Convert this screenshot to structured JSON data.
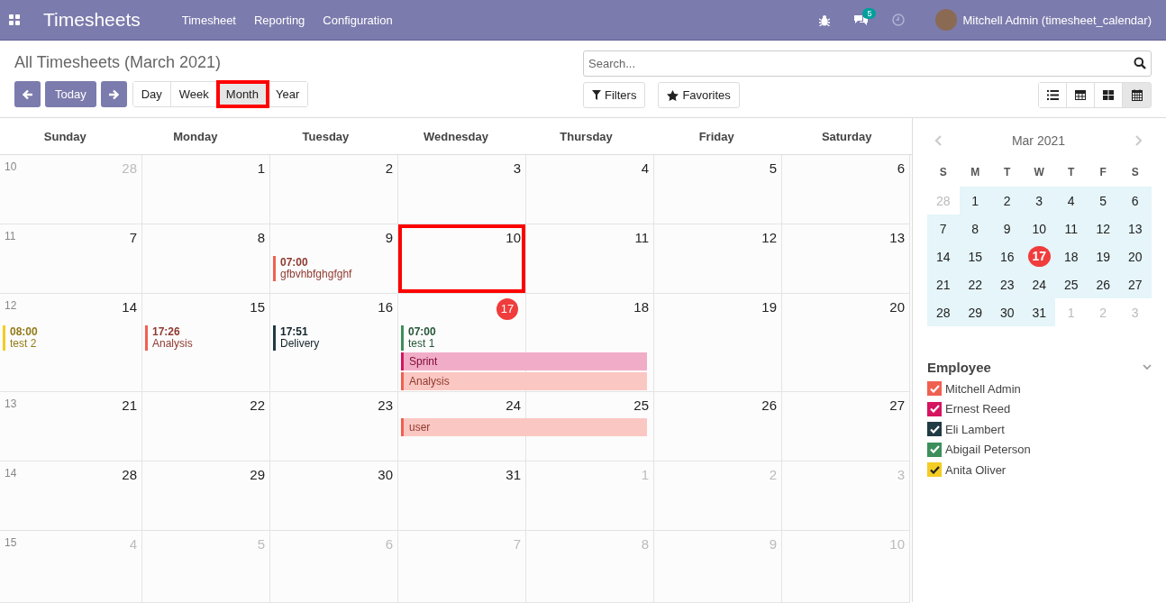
{
  "app": {
    "title": "Timesheets",
    "menu": [
      "Timesheet",
      "Reporting",
      "Configuration"
    ],
    "messages_badge": "5",
    "user": "Mitchell Admin (timesheet_calendar)"
  },
  "page": {
    "title": "All Timesheets (March 2021)",
    "today_button": "Today",
    "views": [
      {
        "label": "Day",
        "selected": false,
        "highlighted": false
      },
      {
        "label": "Week",
        "selected": false,
        "highlighted": false
      },
      {
        "label": "Month",
        "selected": true,
        "highlighted": true
      },
      {
        "label": "Year",
        "selected": false,
        "highlighted": false
      }
    ],
    "search": {
      "placeholder": "Search..."
    },
    "filters": "Filters",
    "favorites": "Favorites",
    "view_switcher": [
      {
        "kind": "list",
        "selected": false
      },
      {
        "kind": "pivot",
        "selected": false
      },
      {
        "kind": "kanban",
        "selected": false
      },
      {
        "kind": "calendar",
        "selected": true
      }
    ]
  },
  "calendar": {
    "weekdays": [
      "Sunday",
      "Monday",
      "Tuesday",
      "Wednesday",
      "Thursday",
      "Friday",
      "Saturday"
    ],
    "weeks": [
      {
        "number": "10",
        "days": [
          {
            "label": "28",
            "in_month": false,
            "today": false,
            "highlighted": false
          },
          {
            "label": "1",
            "in_month": true,
            "today": false,
            "highlighted": false
          },
          {
            "label": "2",
            "in_month": true,
            "today": false,
            "highlighted": false
          },
          {
            "label": "3",
            "in_month": true,
            "today": false,
            "highlighted": false
          },
          {
            "label": "4",
            "in_month": true,
            "today": false,
            "highlighted": false
          },
          {
            "label": "5",
            "in_month": true,
            "today": false,
            "highlighted": false
          },
          {
            "label": "6",
            "in_month": true,
            "today": false,
            "highlighted": false
          }
        ]
      },
      {
        "number": "11",
        "days": [
          {
            "label": "7",
            "in_month": true,
            "today": false,
            "highlighted": false
          },
          {
            "label": "8",
            "in_month": true,
            "today": false,
            "highlighted": false
          },
          {
            "label": "9",
            "in_month": true,
            "today": false,
            "highlighted": false,
            "events": [
              {
                "kind": "timed",
                "time": "07:00",
                "title": "gfbvhbfghgfghf",
                "color": "#f06050"
              }
            ]
          },
          {
            "label": "10",
            "in_month": true,
            "today": false,
            "highlighted": true
          },
          {
            "label": "11",
            "in_month": true,
            "today": false,
            "highlighted": false
          },
          {
            "label": "12",
            "in_month": true,
            "today": false,
            "highlighted": false
          },
          {
            "label": "13",
            "in_month": true,
            "today": false,
            "highlighted": false
          }
        ]
      },
      {
        "number": "12",
        "days": [
          {
            "label": "14",
            "in_month": true,
            "today": false,
            "highlighted": false,
            "events": [
              {
                "kind": "timed",
                "time": "08:00",
                "title": "test 2",
                "color": "#f4cc24"
              }
            ]
          },
          {
            "label": "15",
            "in_month": true,
            "today": false,
            "highlighted": false,
            "events": [
              {
                "kind": "timed",
                "time": "17:26",
                "title": "Analysis",
                "color": "#f06050"
              }
            ]
          },
          {
            "label": "16",
            "in_month": true,
            "today": false,
            "highlighted": false,
            "events": [
              {
                "kind": "timed",
                "time": "17:51",
                "title": "Delivery",
                "color": "#1f3b44"
              }
            ]
          },
          {
            "label": "17",
            "in_month": true,
            "today": true,
            "highlighted": false,
            "events": [
              {
                "kind": "timed",
                "time": "07:00",
                "title": "test 1",
                "color": "#3d8f5b"
              },
              {
                "kind": "bar",
                "title": "Sprint",
                "color": "#d6145f",
                "continues": true
              },
              {
                "kind": "bar",
                "title": "Analysis",
                "color": "#f06050",
                "continues": true
              }
            ]
          },
          {
            "label": "18",
            "in_month": true,
            "today": false,
            "highlighted": false
          },
          {
            "label": "19",
            "in_month": true,
            "today": false,
            "highlighted": false
          },
          {
            "label": "20",
            "in_month": true,
            "today": false,
            "highlighted": false
          }
        ]
      },
      {
        "number": "13",
        "days": [
          {
            "label": "21",
            "in_month": true,
            "today": false,
            "highlighted": false
          },
          {
            "label": "22",
            "in_month": true,
            "today": false,
            "highlighted": false
          },
          {
            "label": "23",
            "in_month": true,
            "today": false,
            "highlighted": false
          },
          {
            "label": "24",
            "in_month": true,
            "today": false,
            "highlighted": false,
            "events": [
              {
                "kind": "bar",
                "title": "user",
                "color": "#f06050",
                "continues": true
              }
            ]
          },
          {
            "label": "25",
            "in_month": true,
            "today": false,
            "highlighted": false
          },
          {
            "label": "26",
            "in_month": true,
            "today": false,
            "highlighted": false
          },
          {
            "label": "27",
            "in_month": true,
            "today": false,
            "highlighted": false
          }
        ]
      },
      {
        "number": "14",
        "days": [
          {
            "label": "28",
            "in_month": true,
            "today": false,
            "highlighted": false
          },
          {
            "label": "29",
            "in_month": true,
            "today": false,
            "highlighted": false
          },
          {
            "label": "30",
            "in_month": true,
            "today": false,
            "highlighted": false
          },
          {
            "label": "31",
            "in_month": true,
            "today": false,
            "highlighted": false
          },
          {
            "label": "1",
            "in_month": false,
            "today": false,
            "highlighted": false
          },
          {
            "label": "2",
            "in_month": false,
            "today": false,
            "highlighted": false
          },
          {
            "label": "3",
            "in_month": false,
            "today": false,
            "highlighted": false
          }
        ]
      },
      {
        "number": "15",
        "days": [
          {
            "label": "4",
            "in_month": false,
            "today": false,
            "highlighted": false
          },
          {
            "label": "5",
            "in_month": false,
            "today": false,
            "highlighted": false
          },
          {
            "label": "6",
            "in_month": false,
            "today": false,
            "highlighted": false
          },
          {
            "label": "7",
            "in_month": false,
            "today": false,
            "highlighted": false
          },
          {
            "label": "8",
            "in_month": false,
            "today": false,
            "highlighted": false
          },
          {
            "label": "9",
            "in_month": false,
            "today": false,
            "highlighted": false
          },
          {
            "label": "10",
            "in_month": false,
            "today": false,
            "highlighted": false
          }
        ]
      }
    ]
  },
  "mini_calendar": {
    "title": "Mar 2021",
    "weekdays": [
      "S",
      "M",
      "T",
      "W",
      "T",
      "F",
      "S"
    ],
    "days": [
      {
        "label": "28",
        "in_month": false,
        "today": false
      },
      {
        "label": "1",
        "in_month": true,
        "today": false
      },
      {
        "label": "2",
        "in_month": true,
        "today": false
      },
      {
        "label": "3",
        "in_month": true,
        "today": false
      },
      {
        "label": "4",
        "in_month": true,
        "today": false
      },
      {
        "label": "5",
        "in_month": true,
        "today": false
      },
      {
        "label": "6",
        "in_month": true,
        "today": false
      },
      {
        "label": "7",
        "in_month": true,
        "today": false
      },
      {
        "label": "8",
        "in_month": true,
        "today": false
      },
      {
        "label": "9",
        "in_month": true,
        "today": false
      },
      {
        "label": "10",
        "in_month": true,
        "today": false
      },
      {
        "label": "11",
        "in_month": true,
        "today": false
      },
      {
        "label": "12",
        "in_month": true,
        "today": false
      },
      {
        "label": "13",
        "in_month": true,
        "today": false
      },
      {
        "label": "14",
        "in_month": true,
        "today": false
      },
      {
        "label": "15",
        "in_month": true,
        "today": false
      },
      {
        "label": "16",
        "in_month": true,
        "today": false
      },
      {
        "label": "17",
        "in_month": true,
        "today": true
      },
      {
        "label": "18",
        "in_month": true,
        "today": false
      },
      {
        "label": "19",
        "in_month": true,
        "today": false
      },
      {
        "label": "20",
        "in_month": true,
        "today": false
      },
      {
        "label": "21",
        "in_month": true,
        "today": false
      },
      {
        "label": "22",
        "in_month": true,
        "today": false
      },
      {
        "label": "23",
        "in_month": true,
        "today": false
      },
      {
        "label": "24",
        "in_month": true,
        "today": false
      },
      {
        "label": "25",
        "in_month": true,
        "today": false
      },
      {
        "label": "26",
        "in_month": true,
        "today": false
      },
      {
        "label": "27",
        "in_month": true,
        "today": false
      },
      {
        "label": "28",
        "in_month": true,
        "today": false
      },
      {
        "label": "29",
        "in_month": true,
        "today": false
      },
      {
        "label": "30",
        "in_month": true,
        "today": false
      },
      {
        "label": "31",
        "in_month": true,
        "today": false
      },
      {
        "label": "1",
        "in_month": false,
        "today": false
      },
      {
        "label": "2",
        "in_month": false,
        "today": false
      },
      {
        "label": "3",
        "in_month": false,
        "today": false
      }
    ]
  },
  "employee_filter": {
    "title": "Employee",
    "items": [
      {
        "name": "Mitchell Admin",
        "checked": true,
        "color": "#f06050"
      },
      {
        "name": "Ernest Reed",
        "checked": true,
        "color": "#d6145f"
      },
      {
        "name": "Eli Lambert",
        "checked": true,
        "color": "#1f3b44"
      },
      {
        "name": "Abigail Peterson",
        "checked": true,
        "color": "#3d8f5b"
      },
      {
        "name": "Anita Oliver",
        "checked": true,
        "color": "#f4cc24"
      }
    ]
  }
}
